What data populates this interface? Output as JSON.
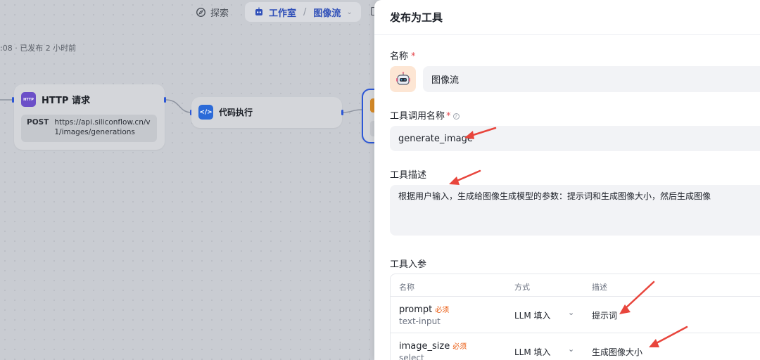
{
  "header": {
    "explore_label": "探索",
    "breadcrumb": [
      "工作室",
      "图像流"
    ]
  },
  "canvas": {
    "meta_text": ":08 · 已发布 2 小时前",
    "http_node": {
      "badge": "HTTP",
      "title": "HTTP 请求",
      "method": "POST",
      "url": "https://api.siliconflow.cn/v1/images/generations"
    },
    "code_node": {
      "badge": "</>",
      "title": "代码执行"
    }
  },
  "panel": {
    "title": "发布为工具",
    "name_label": "名称",
    "name_required": "*",
    "name_value": "图像流",
    "call_name_label": "工具调用名称",
    "call_name_required": "*",
    "call_name_help": "?",
    "call_name_value": "generate_image",
    "desc_label": "工具描述",
    "desc_value": "根据用户输入，生成给图像生成模型的参数：提示词和生成图像大小，然后生成图像",
    "params_label": "工具入参",
    "params_headers": [
      "名称",
      "方式",
      "描述"
    ],
    "params": [
      {
        "name": "prompt",
        "required": "必须",
        "type": "text-input",
        "mode": "LLM 填入",
        "desc": "提示词"
      },
      {
        "name": "image_size",
        "required": "必须",
        "type": "select",
        "mode": "LLM 填入",
        "desc": "生成图像大小"
      }
    ]
  },
  "colors": {
    "accent": "#2c57d6",
    "required": "#e5484d",
    "must": "#ea580c",
    "annotation_arrow": "#e8453c"
  }
}
